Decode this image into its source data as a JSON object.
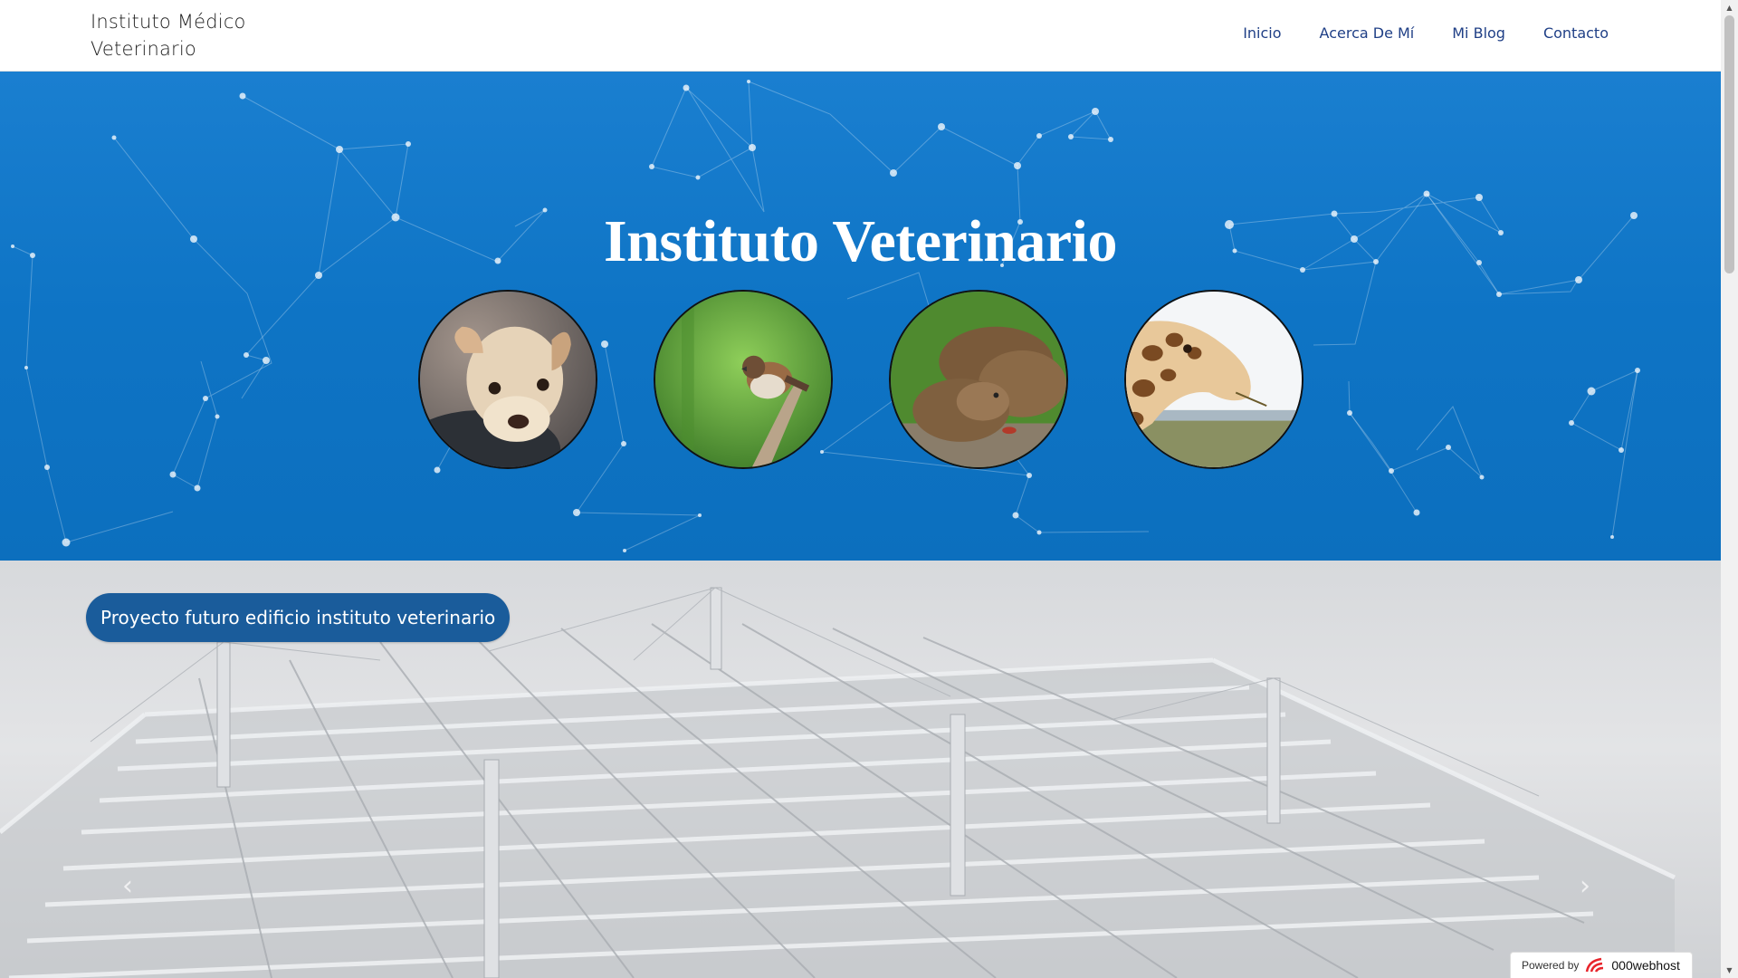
{
  "header": {
    "brand_line1": "Instituto Médico",
    "brand_line2": "Veterinario",
    "nav": [
      {
        "label": "Inicio"
      },
      {
        "label": "Acerca De Mí"
      },
      {
        "label": "Mi Blog"
      },
      {
        "label": "Contacto"
      }
    ]
  },
  "hero": {
    "title": "Instituto Veterinario",
    "images": [
      {
        "icon": "dog-image"
      },
      {
        "icon": "sparrow-image"
      },
      {
        "icon": "capybara-image"
      },
      {
        "icon": "giraffe-image"
      }
    ]
  },
  "section": {
    "caption": "Proyecto futuro edificio instituto veterinario",
    "prev_arrow": "‹",
    "next_arrow": "›"
  },
  "footer_badge": {
    "powered": "Powered by",
    "host": "000webhost"
  },
  "colors": {
    "hero_blue": "#0e74c5",
    "nav_text": "#1f3f86",
    "pill_bg": "#1a5c9b"
  }
}
